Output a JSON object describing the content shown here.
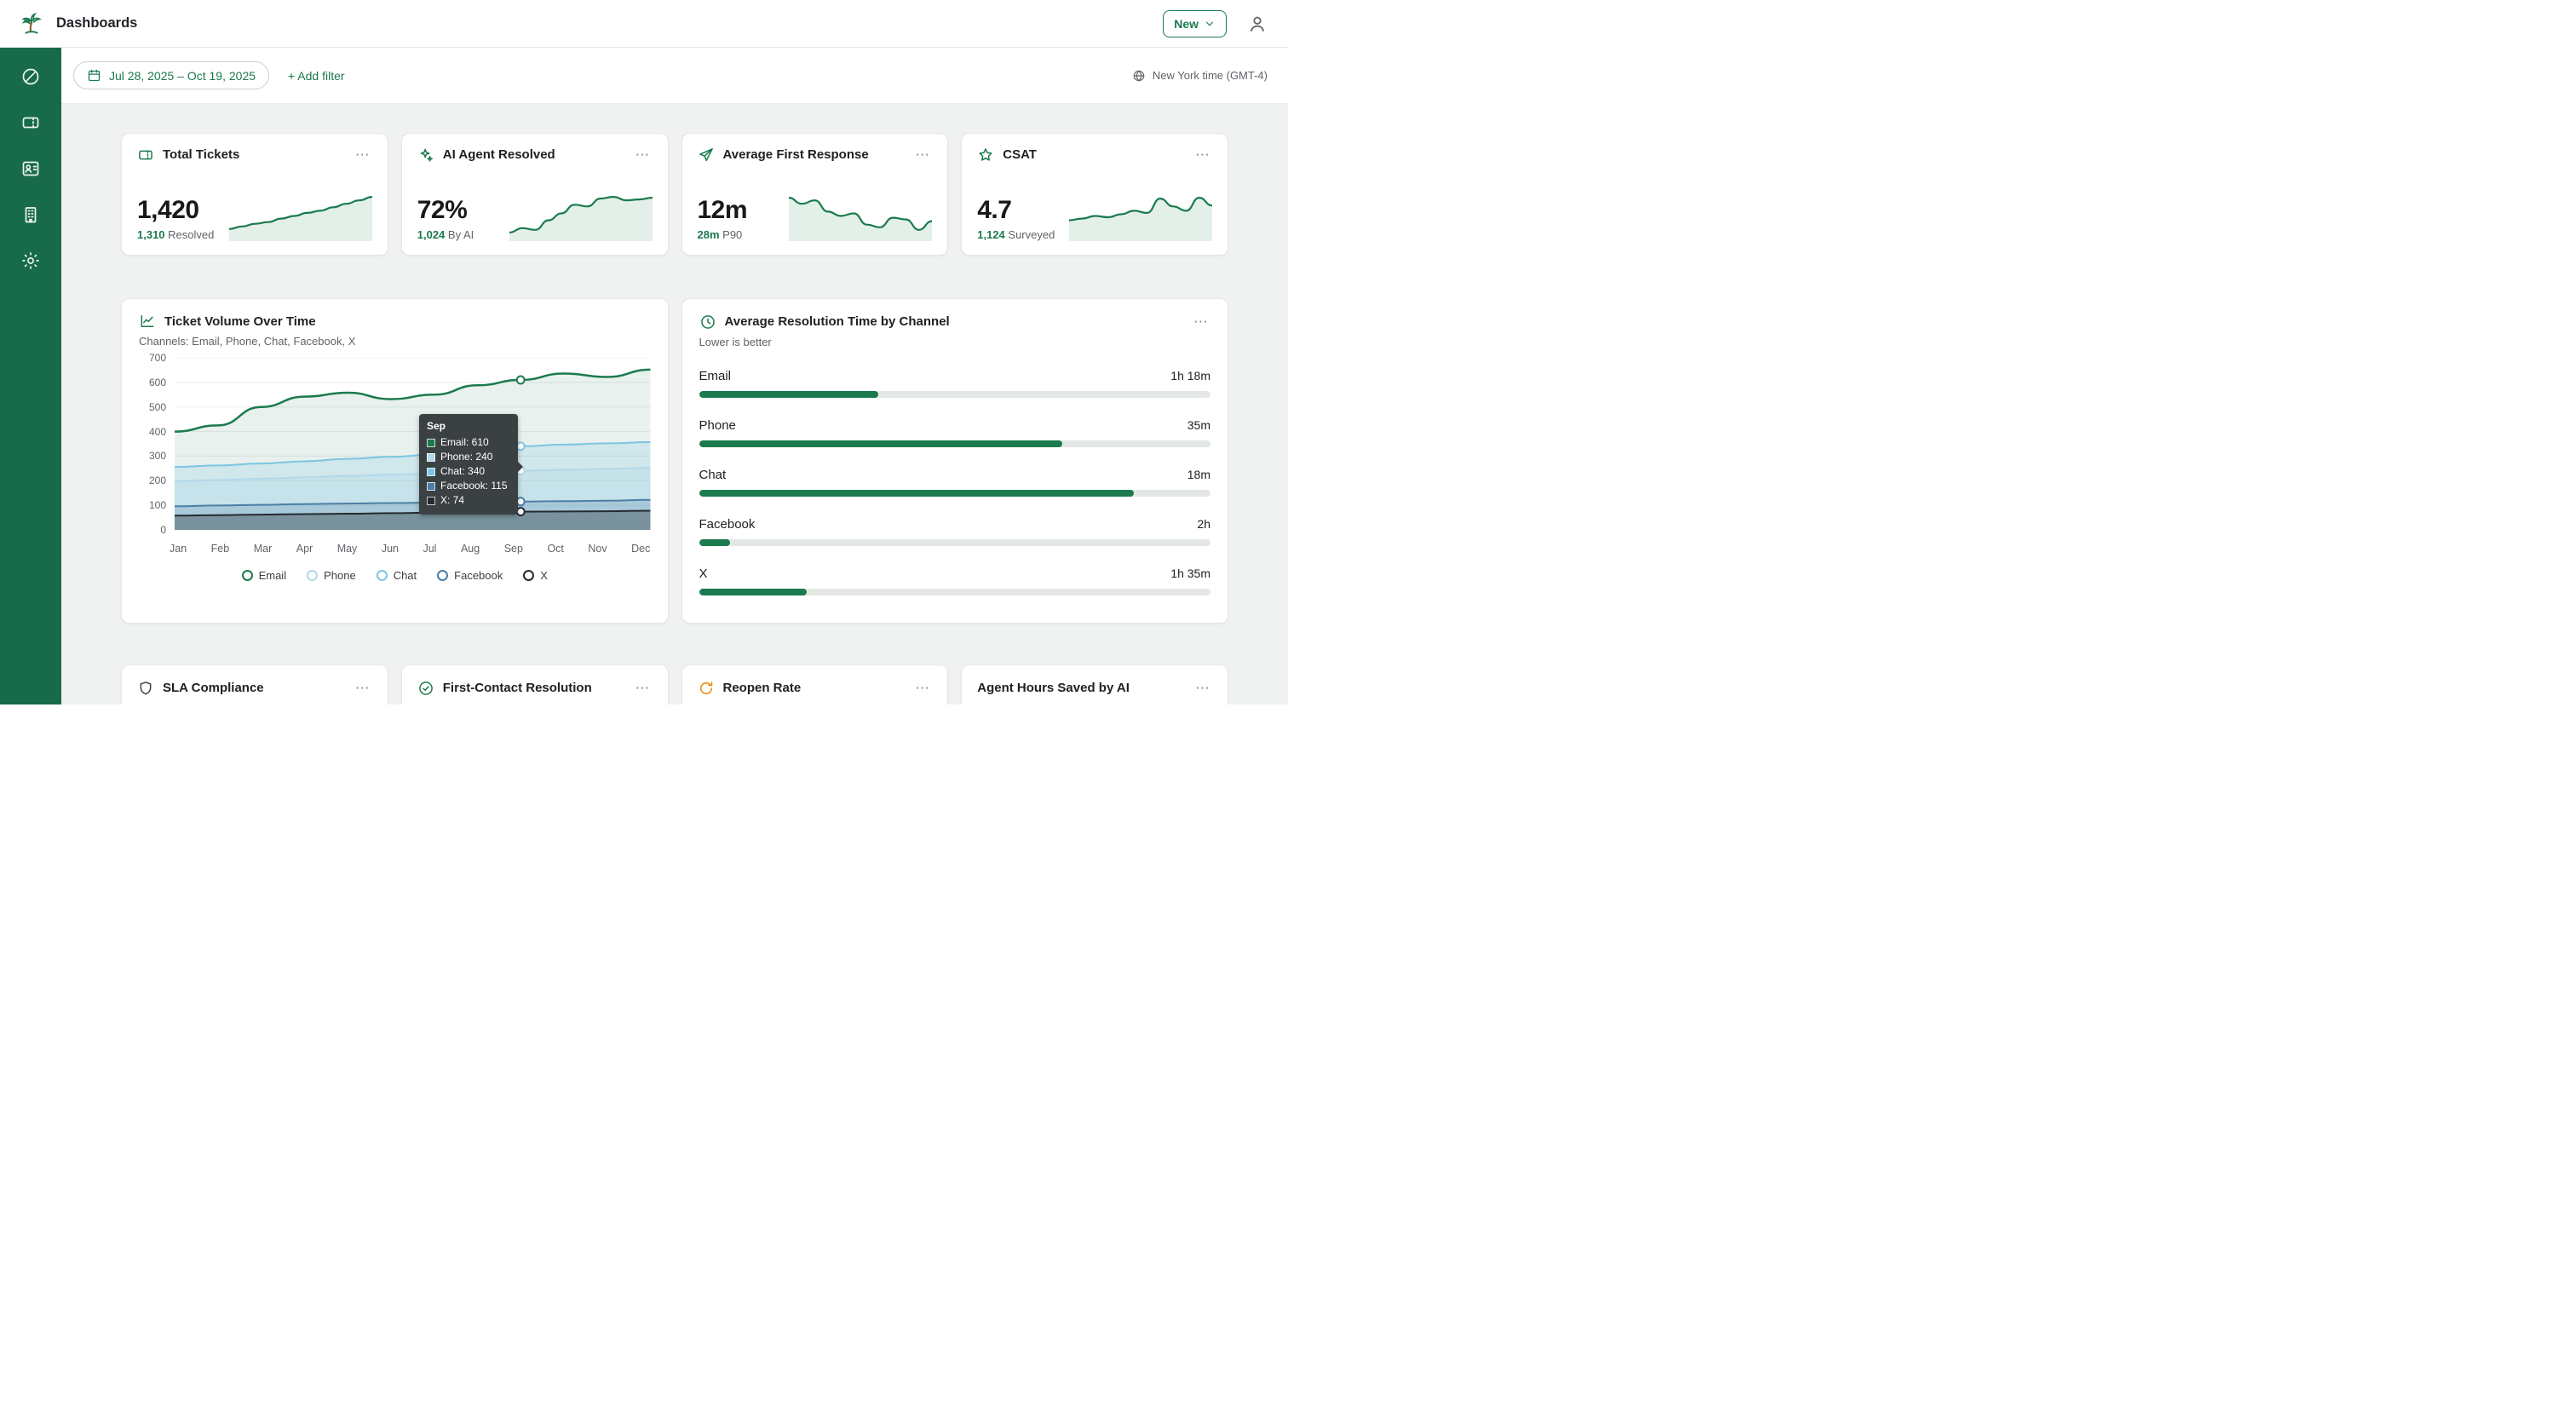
{
  "accent": {
    "green": "#1b7a4e",
    "sidebar_green": "#176b4a",
    "amber": "#e8870a"
  },
  "topbar": {
    "title": "Dashboards",
    "new_button": "New"
  },
  "sidebar": {
    "icons": [
      "dashboard-icon",
      "ticket-icon",
      "contacts-icon",
      "organizations-icon",
      "settings-icon"
    ]
  },
  "filter_bar": {
    "date_range": "Jul 28, 2025 – Oct 19, 2025",
    "add_filter": "+ Add filter",
    "timezone": "New York time (GMT-4)"
  },
  "kpi_cards": [
    {
      "icon": "ticket-icon",
      "title": "Total Tickets",
      "value": "1,420",
      "sub_strong": "1,310",
      "sub_rest": " Resolved",
      "spark": [
        18,
        24,
        30,
        34,
        42,
        48,
        55,
        60,
        68,
        76,
        84,
        92
      ]
    },
    {
      "icon": "sparkles-icon",
      "title": "AI Agent Resolved",
      "value": "72%",
      "sub_strong": "1,024",
      "sub_rest": " By AI",
      "spark": [
        10,
        20,
        16,
        38,
        54,
        74,
        70,
        88,
        92,
        84,
        86,
        90
      ]
    },
    {
      "icon": "paper-plane-icon",
      "title": "Average First Response",
      "value": "12m",
      "sub_strong": "28m",
      "sub_rest": " P90",
      "spark": [
        90,
        76,
        84,
        58,
        48,
        54,
        28,
        22,
        44,
        40,
        16,
        36
      ]
    },
    {
      "icon": "star-icon",
      "title": "CSAT",
      "value": "4.7",
      "sub_strong": "1,124",
      "sub_rest": " Surveyed",
      "spark": [
        38,
        42,
        48,
        45,
        52,
        60,
        55,
        88,
        70,
        60,
        90,
        72
      ]
    }
  ],
  "chart_data": {
    "type": "line",
    "title": "Ticket Volume Over Time",
    "subtitle": "Channels: Email, Phone, Chat, Facebook, X",
    "x": [
      "Jan",
      "Feb",
      "Mar",
      "Apr",
      "May",
      "Jun",
      "Jul",
      "Aug",
      "Sep",
      "Oct",
      "Nov",
      "Dec"
    ],
    "ylim": [
      0,
      700
    ],
    "yticks": [
      0,
      100,
      200,
      300,
      400,
      500,
      600,
      700
    ],
    "highlight_index": 8,
    "legend_position": "bottom",
    "grid": true,
    "series": [
      {
        "name": "Email",
        "color": "#1b7a4e",
        "values": [
          400,
          425,
          500,
          542,
          558,
          532,
          550,
          588,
          610,
          636,
          622,
          652
        ]
      },
      {
        "name": "Phone",
        "color": "#b3d8e8",
        "values": [
          198,
          203,
          208,
          214,
          219,
          225,
          229,
          235,
          240,
          244,
          248,
          252
        ]
      },
      {
        "name": "Chat",
        "color": "#7cc5e3",
        "values": [
          256,
          262,
          270,
          279,
          289,
          297,
          307,
          321,
          340,
          347,
          352,
          357
        ]
      },
      {
        "name": "Facebook",
        "color": "#4d7fa6",
        "values": [
          96,
          99,
          102,
          105,
          107,
          109,
          111,
          113,
          115,
          117,
          119,
          122
        ]
      },
      {
        "name": "X",
        "color": "#252b2e",
        "values": [
          58,
          60,
          62,
          64,
          66,
          68,
          70,
          72,
          74,
          75,
          76,
          78
        ]
      }
    ]
  },
  "tooltip": {
    "title": "Sep",
    "rows": [
      {
        "text": "Email: 610",
        "color": "#1b7a4e"
      },
      {
        "text": "Phone: 240",
        "color": "#b3d8e8"
      },
      {
        "text": "Chat: 340",
        "color": "#7cc5e3"
      },
      {
        "text": "Facebook: 115",
        "color": "#4d7fa6"
      },
      {
        "text": "X: 74",
        "color": "#252b2e"
      }
    ]
  },
  "resolution_card": {
    "title": "Average Resolution Time by Channel",
    "subtitle": "Lower is better",
    "rows": [
      {
        "label": "Email",
        "time": "1h 18m",
        "bar": "35%"
      },
      {
        "label": "Phone",
        "time": "35m",
        "bar": "71%"
      },
      {
        "label": "Chat",
        "time": "18m",
        "bar": "85%"
      },
      {
        "label": "Facebook",
        "time": "2h",
        "bar": "6%"
      },
      {
        "label": "X",
        "time": "1h 35m",
        "bar": "21%"
      }
    ]
  },
  "bottom_cards": [
    {
      "icon": "shield-icon",
      "title": "SLA Compliance"
    },
    {
      "icon": "check-circle-icon",
      "title": "First-Contact Resolution"
    },
    {
      "icon": "refresh-icon",
      "title": "Reopen Rate"
    },
    {
      "icon": "",
      "title": "Agent Hours Saved by AI"
    }
  ]
}
